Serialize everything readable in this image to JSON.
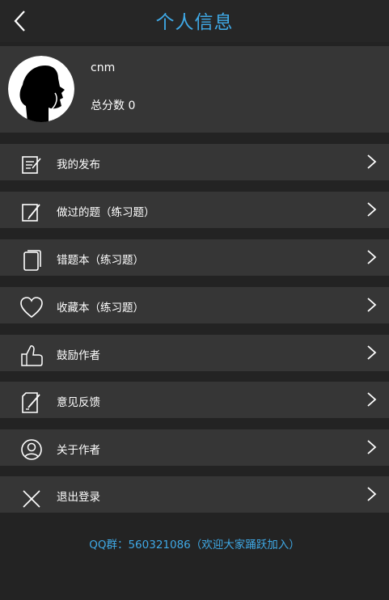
{
  "header": {
    "title": "个人信息"
  },
  "profile": {
    "username": "cnm",
    "score_text": "总分数 0"
  },
  "menu": [
    {
      "id": "my-posts",
      "icon": "edit-document-icon",
      "label": "我的发布"
    },
    {
      "id": "done-questions",
      "icon": "note-pencil-icon",
      "label": "做过的题（练习题）"
    },
    {
      "id": "wrong-questions",
      "icon": "copy-pages-icon",
      "label": "错题本（练习题）"
    },
    {
      "id": "favorites",
      "icon": "heart-icon",
      "label": "收藏本（练习题）"
    },
    {
      "id": "encourage-author",
      "icon": "thumbs-up-icon",
      "label": "鼓励作者"
    },
    {
      "id": "feedback",
      "icon": "feedback-pencil-icon",
      "label": "意见反馈"
    },
    {
      "id": "about-author",
      "icon": "user-circle-icon",
      "label": "关于作者"
    },
    {
      "id": "logout",
      "icon": "close-x-icon",
      "label": "退出登录"
    }
  ],
  "footer": {
    "text": "QQ群：560321086（欢迎大家踊跃加入）"
  },
  "colors": {
    "accent": "#3fa9e6",
    "background": "#232323",
    "row": "#363636"
  }
}
